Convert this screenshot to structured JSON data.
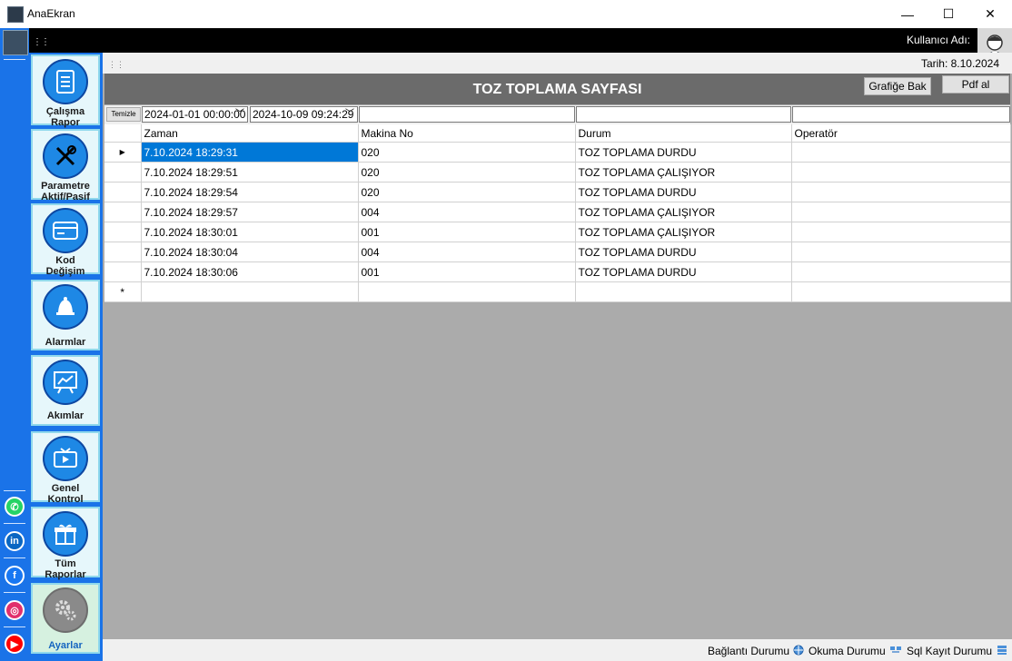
{
  "window": {
    "title": "AnaEkran",
    "minimize": "—",
    "maximize": "☐",
    "close": "✕"
  },
  "topbar": {
    "user_label": "Kullanıcı Adı:",
    "grip": "⋮⋮"
  },
  "datebar": {
    "date_text": "Tarih: 8.10.2024",
    "grip": "⋮⋮"
  },
  "page": {
    "title": "TOZ TOPLAMA SAYFASI",
    "chart_button": "Grafiğe Bak",
    "pdf_button": "Pdf al"
  },
  "filters": {
    "clear_button": "Temizle",
    "start_date": "2024-01-01 00:00:00",
    "end_date": "2024-10-09 09:24:29"
  },
  "nav": {
    "items": [
      {
        "label1": "Çalışma",
        "label2": "Rapor",
        "icon": "document-icon"
      },
      {
        "label1": "Parametre",
        "label2": "Aktif/Pasif",
        "icon": "tools-icon"
      },
      {
        "label1": "Kod",
        "label2": "Değişim",
        "icon": "card-icon"
      },
      {
        "label1": "Alarmlar",
        "label2": "",
        "icon": "bell-icon"
      },
      {
        "label1": "Akımlar",
        "label2": "",
        "icon": "chart-board-icon"
      },
      {
        "label1": "Genel",
        "label2": "Kontrol",
        "icon": "tv-icon"
      },
      {
        "label1": "Tüm",
        "label2": "Raporlar",
        "icon": "gift-icon"
      },
      {
        "label1": "Ayarlar",
        "label2": "",
        "icon": "gears-icon"
      }
    ]
  },
  "social": [
    "whatsapp-icon",
    "linkedin-icon",
    "facebook-icon",
    "instagram-icon",
    "youtube-icon"
  ],
  "table": {
    "columns": [
      "Zaman",
      "Makina No",
      "Durum",
      "Operatör"
    ],
    "rows": [
      [
        "7.10.2024 18:29:31",
        "020",
        "TOZ TOPLAMA DURDU",
        ""
      ],
      [
        "7.10.2024 18:29:51",
        "020",
        "TOZ TOPLAMA ÇALIŞIYOR",
        ""
      ],
      [
        "7.10.2024 18:29:54",
        "020",
        "TOZ TOPLAMA DURDU",
        ""
      ],
      [
        "7.10.2024 18:29:57",
        "004",
        "TOZ TOPLAMA ÇALIŞIYOR",
        ""
      ],
      [
        "7.10.2024 18:30:01",
        "001",
        "TOZ TOPLAMA ÇALIŞIYOR",
        ""
      ],
      [
        "7.10.2024 18:30:04",
        "004",
        "TOZ TOPLAMA DURDU",
        ""
      ],
      [
        "7.10.2024 18:30:06",
        "001",
        "TOZ TOPLAMA DURDU",
        ""
      ]
    ],
    "current_row_marker": "▶",
    "new_row_marker": "*"
  },
  "status": {
    "connection": "Bağlantı Durumu",
    "reading": "Okuma Durumu",
    "sql": "Sql Kayıt Durumu"
  }
}
